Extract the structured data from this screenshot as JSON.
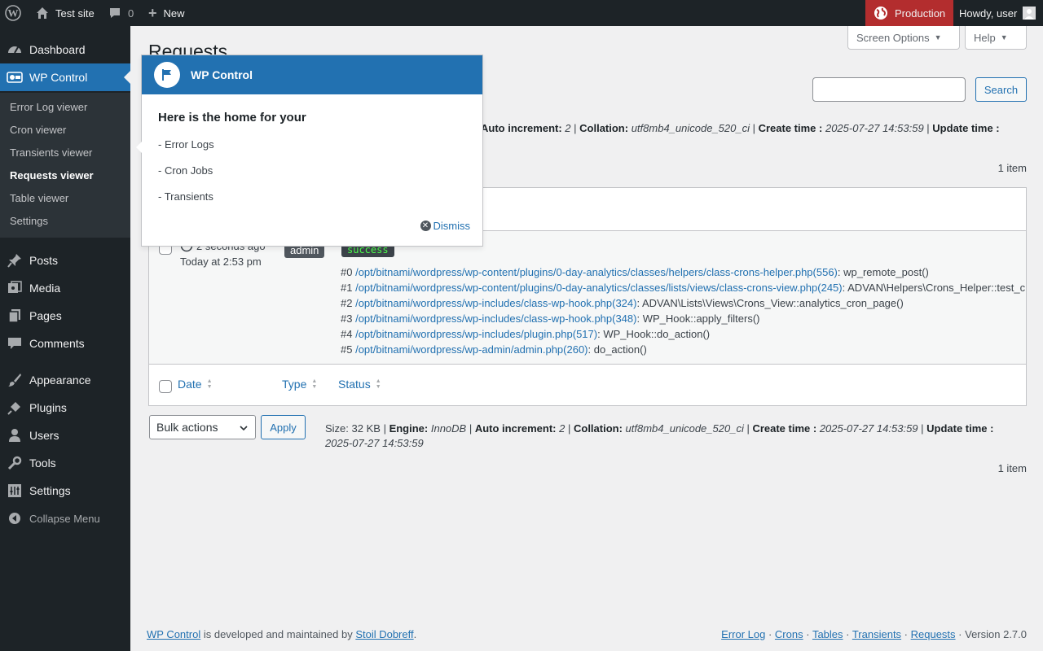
{
  "adminbar": {
    "site_name": "Test site",
    "comments_count": "0",
    "new_label": "New",
    "environment": "Production",
    "howdy": "Howdy, user"
  },
  "sidebar": {
    "items": [
      {
        "label": "Dashboard",
        "icon": "dashboard-icon"
      },
      {
        "label": "WP Control",
        "icon": "wp-control-icon"
      },
      {
        "label": "Posts",
        "icon": "pin-icon"
      },
      {
        "label": "Media",
        "icon": "media-icon"
      },
      {
        "label": "Pages",
        "icon": "pages-icon"
      },
      {
        "label": "Comments",
        "icon": "comment-icon"
      },
      {
        "label": "Appearance",
        "icon": "brush-icon"
      },
      {
        "label": "Plugins",
        "icon": "plug-icon"
      },
      {
        "label": "Users",
        "icon": "user-icon"
      },
      {
        "label": "Tools",
        "icon": "wrench-icon"
      },
      {
        "label": "Settings",
        "icon": "sliders-icon"
      }
    ],
    "submenu": [
      "Error Log viewer",
      "Cron viewer",
      "Transients viewer",
      "Requests viewer",
      "Table viewer",
      "Settings"
    ],
    "collapse": "Collapse Menu"
  },
  "page": {
    "title": "Requests",
    "screen_options": "Screen Options",
    "help": "Help",
    "search_button": "Search",
    "count": "1 item"
  },
  "tableinfo_top": {
    "autoinc_label": "Auto increment:",
    "autoinc": "2",
    "collation_label": "Collation:",
    "collation": "utf8mb4_unicode_520_ci",
    "create_label": "Create time :",
    "create": "2025-07-27 14:53:59",
    "update_label": "Update time :"
  },
  "tableinfo_bottom": {
    "size_label": "Size:",
    "size": "32 KB",
    "engine_label": "Engine:",
    "engine": "InnoDB",
    "autoinc_label": "Auto increment:",
    "autoinc": "2",
    "collation_label": "Collation:",
    "collation": "utf8mb4_unicode_520_ci",
    "create_label": "Create time :",
    "create": "2025-07-27 14:53:59",
    "update_label": "Update time :",
    "update": "2025-07-27 14:53:59"
  },
  "row": {
    "ago": "2 seconds ago",
    "date": "Today at 2:53 pm",
    "user": "admin",
    "status": "success",
    "trace": [
      {
        "n": "#0",
        "path": "/opt/bitnami/wordpress/wp-content/plugins/0-day-analytics/classes/helpers/class-crons-helper.php(556)",
        "call": ": wp_remote_post()"
      },
      {
        "n": "#1",
        "path": "/opt/bitnami/wordpress/wp-content/plugins/0-day-analytics/classes/lists/views/class-crons-view.php(245)",
        "call": ": ADVAN\\Helpers\\Crons_Helper::test_c"
      },
      {
        "n": "#2",
        "path": "/opt/bitnami/wordpress/wp-includes/class-wp-hook.php(324)",
        "call": ": ADVAN\\Lists\\Views\\Crons_View::analytics_cron_page()"
      },
      {
        "n": "#3",
        "path": "/opt/bitnami/wordpress/wp-includes/class-wp-hook.php(348)",
        "call": ": WP_Hook::apply_filters()"
      },
      {
        "n": "#4",
        "path": "/opt/bitnami/wordpress/wp-includes/plugin.php(517)",
        "call": ": WP_Hook::do_action()"
      },
      {
        "n": "#5",
        "path": "/opt/bitnami/wordpress/wp-admin/admin.php(260)",
        "call": ": do_action()"
      }
    ]
  },
  "columns": {
    "date": "Date",
    "type": "Type",
    "status": "Status"
  },
  "bulk": {
    "selected": "Bulk actions",
    "apply": "Apply"
  },
  "pointer": {
    "header": "WP Control",
    "title": "Here is the home for your",
    "lines": [
      "- Error Logs",
      "- Cron Jobs",
      "- Transients"
    ],
    "dismiss": "Dismiss"
  },
  "footer": {
    "plugin_link": "WP Control",
    "mid_text": " is developed and maintained by ",
    "author": "Stoil Dobreff",
    "links": [
      "Error Log",
      "Crons",
      "Tables",
      "Transients",
      "Requests"
    ],
    "version": "· Version 2.7.0"
  }
}
